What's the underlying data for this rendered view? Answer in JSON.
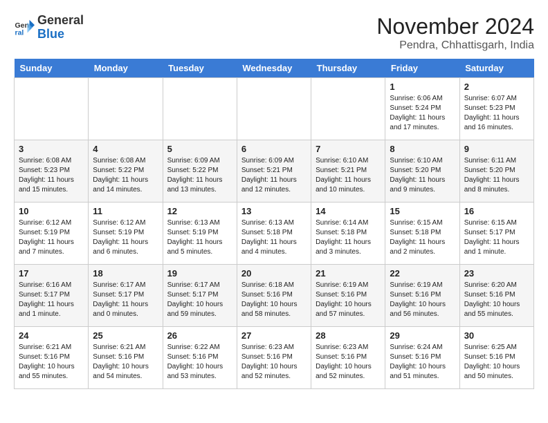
{
  "header": {
    "logo_general": "General",
    "logo_blue": "Blue",
    "month_year": "November 2024",
    "location": "Pendra, Chhattisgarh, India"
  },
  "weekdays": [
    "Sunday",
    "Monday",
    "Tuesday",
    "Wednesday",
    "Thursday",
    "Friday",
    "Saturday"
  ],
  "weeks": [
    [
      {
        "day": "",
        "info": ""
      },
      {
        "day": "",
        "info": ""
      },
      {
        "day": "",
        "info": ""
      },
      {
        "day": "",
        "info": ""
      },
      {
        "day": "",
        "info": ""
      },
      {
        "day": "1",
        "info": "Sunrise: 6:06 AM\nSunset: 5:24 PM\nDaylight: 11 hours\nand 17 minutes."
      },
      {
        "day": "2",
        "info": "Sunrise: 6:07 AM\nSunset: 5:23 PM\nDaylight: 11 hours\nand 16 minutes."
      }
    ],
    [
      {
        "day": "3",
        "info": "Sunrise: 6:08 AM\nSunset: 5:23 PM\nDaylight: 11 hours\nand 15 minutes."
      },
      {
        "day": "4",
        "info": "Sunrise: 6:08 AM\nSunset: 5:22 PM\nDaylight: 11 hours\nand 14 minutes."
      },
      {
        "day": "5",
        "info": "Sunrise: 6:09 AM\nSunset: 5:22 PM\nDaylight: 11 hours\nand 13 minutes."
      },
      {
        "day": "6",
        "info": "Sunrise: 6:09 AM\nSunset: 5:21 PM\nDaylight: 11 hours\nand 12 minutes."
      },
      {
        "day": "7",
        "info": "Sunrise: 6:10 AM\nSunset: 5:21 PM\nDaylight: 11 hours\nand 10 minutes."
      },
      {
        "day": "8",
        "info": "Sunrise: 6:10 AM\nSunset: 5:20 PM\nDaylight: 11 hours\nand 9 minutes."
      },
      {
        "day": "9",
        "info": "Sunrise: 6:11 AM\nSunset: 5:20 PM\nDaylight: 11 hours\nand 8 minutes."
      }
    ],
    [
      {
        "day": "10",
        "info": "Sunrise: 6:12 AM\nSunset: 5:19 PM\nDaylight: 11 hours\nand 7 minutes."
      },
      {
        "day": "11",
        "info": "Sunrise: 6:12 AM\nSunset: 5:19 PM\nDaylight: 11 hours\nand 6 minutes."
      },
      {
        "day": "12",
        "info": "Sunrise: 6:13 AM\nSunset: 5:19 PM\nDaylight: 11 hours\nand 5 minutes."
      },
      {
        "day": "13",
        "info": "Sunrise: 6:13 AM\nSunset: 5:18 PM\nDaylight: 11 hours\nand 4 minutes."
      },
      {
        "day": "14",
        "info": "Sunrise: 6:14 AM\nSunset: 5:18 PM\nDaylight: 11 hours\nand 3 minutes."
      },
      {
        "day": "15",
        "info": "Sunrise: 6:15 AM\nSunset: 5:18 PM\nDaylight: 11 hours\nand 2 minutes."
      },
      {
        "day": "16",
        "info": "Sunrise: 6:15 AM\nSunset: 5:17 PM\nDaylight: 11 hours\nand 1 minute."
      }
    ],
    [
      {
        "day": "17",
        "info": "Sunrise: 6:16 AM\nSunset: 5:17 PM\nDaylight: 11 hours\nand 1 minute."
      },
      {
        "day": "18",
        "info": "Sunrise: 6:17 AM\nSunset: 5:17 PM\nDaylight: 11 hours\nand 0 minutes."
      },
      {
        "day": "19",
        "info": "Sunrise: 6:17 AM\nSunset: 5:17 PM\nDaylight: 10 hours\nand 59 minutes."
      },
      {
        "day": "20",
        "info": "Sunrise: 6:18 AM\nSunset: 5:16 PM\nDaylight: 10 hours\nand 58 minutes."
      },
      {
        "day": "21",
        "info": "Sunrise: 6:19 AM\nSunset: 5:16 PM\nDaylight: 10 hours\nand 57 minutes."
      },
      {
        "day": "22",
        "info": "Sunrise: 6:19 AM\nSunset: 5:16 PM\nDaylight: 10 hours\nand 56 minutes."
      },
      {
        "day": "23",
        "info": "Sunrise: 6:20 AM\nSunset: 5:16 PM\nDaylight: 10 hours\nand 55 minutes."
      }
    ],
    [
      {
        "day": "24",
        "info": "Sunrise: 6:21 AM\nSunset: 5:16 PM\nDaylight: 10 hours\nand 55 minutes."
      },
      {
        "day": "25",
        "info": "Sunrise: 6:21 AM\nSunset: 5:16 PM\nDaylight: 10 hours\nand 54 minutes."
      },
      {
        "day": "26",
        "info": "Sunrise: 6:22 AM\nSunset: 5:16 PM\nDaylight: 10 hours\nand 53 minutes."
      },
      {
        "day": "27",
        "info": "Sunrise: 6:23 AM\nSunset: 5:16 PM\nDaylight: 10 hours\nand 52 minutes."
      },
      {
        "day": "28",
        "info": "Sunrise: 6:23 AM\nSunset: 5:16 PM\nDaylight: 10 hours\nand 52 minutes."
      },
      {
        "day": "29",
        "info": "Sunrise: 6:24 AM\nSunset: 5:16 PM\nDaylight: 10 hours\nand 51 minutes."
      },
      {
        "day": "30",
        "info": "Sunrise: 6:25 AM\nSunset: 5:16 PM\nDaylight: 10 hours\nand 50 minutes."
      }
    ]
  ]
}
